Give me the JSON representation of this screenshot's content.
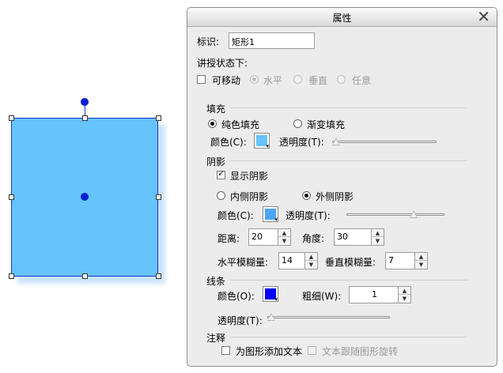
{
  "dialog": {
    "title": "属性",
    "close_icon": "close-icon",
    "identifier_label": "标识:",
    "identifier_value": "矩形1",
    "state_label": "讲授状态下:",
    "movable_label": "可移动",
    "horizontal_label": "水平",
    "vertical_label": "垂直",
    "any_label": "任意"
  },
  "fill": {
    "section": "填充",
    "solid_label": "纯色填充",
    "gradient_label": "渐变填充",
    "color_label": "颜色(C):",
    "color": "#66c3fb",
    "opacity_label": "透明度(T):",
    "opacity": 0
  },
  "shadow": {
    "section": "阴影",
    "show_label": "显示阴影",
    "inner_label": "内侧阴影",
    "outer_label": "外侧阴影",
    "color_label": "颜色(C):",
    "color": "#4da6f5",
    "opacity_label": "透明度(T):",
    "opacity": 0.7,
    "distance_label": "距离:",
    "distance": "20",
    "angle_label": "角度:",
    "angle": "30",
    "hblur_label": "水平模糊量:",
    "hblur": "14",
    "vblur_label": "垂直模糊量:",
    "vblur": "7"
  },
  "line": {
    "section": "线条",
    "color_label": "颜色(O):",
    "color": "#0000ff",
    "width_label": "粗细(W):",
    "width": "1",
    "opacity_label": "透明度(T):",
    "opacity": 0
  },
  "note": {
    "section": "注释",
    "add_text_label": "为图形添加文本",
    "follow_rotate_label": "文本跟随图形旋转"
  },
  "canvas": {
    "shape_fill": "#66c3fb",
    "shape_border": "#1a33c8"
  }
}
